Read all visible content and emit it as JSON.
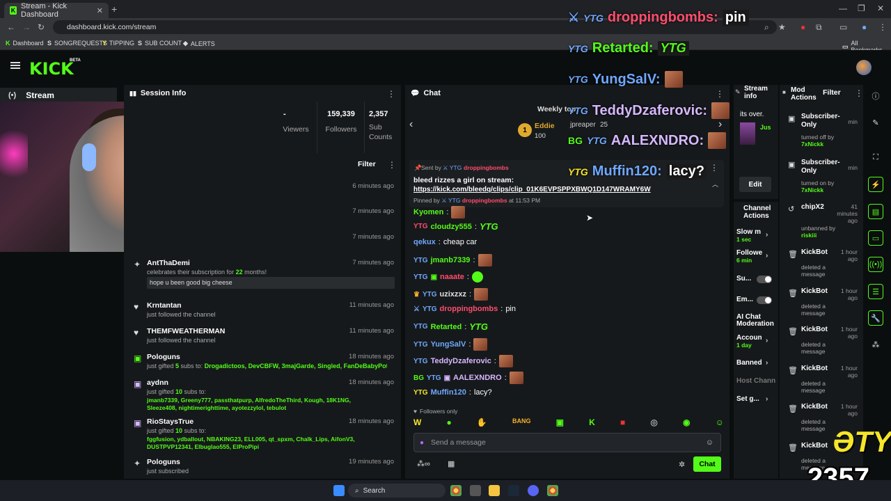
{
  "browser": {
    "tab_title": "Stream - Kick Dashboard",
    "url": "dashboard.kick.com/stream",
    "bookmarks": [
      "Dashboard",
      "SONGREQUESTS",
      "TIPPING",
      "SUB COUNT",
      "ALERTS"
    ],
    "all_bookmarks": "All Bookmarks"
  },
  "header": {
    "logo": "KICK",
    "beta": "BETA"
  },
  "nav": {
    "stream_label": "Stream"
  },
  "session_info": {
    "title": "Session Info",
    "viewers_value": "-",
    "viewers_label": "Viewers",
    "followers_value": "159,339",
    "followers_label": "Followers",
    "subs_value": "2,357",
    "subs_label": "Sub Counts",
    "filter_label": "Filter",
    "events": [
      {
        "user": "",
        "desc": "",
        "time": "6 minutes ago"
      },
      {
        "user": "",
        "desc": "",
        "time": "7 minutes ago"
      },
      {
        "user": "",
        "desc": "",
        "time": "7 minutes ago"
      },
      {
        "user": "AntThaDemi",
        "desc_prefix": "celebrates their subscription for ",
        "desc_months": "22",
        "desc_suffix": " months!",
        "message": "hope u been good big cheese",
        "time": "7 minutes ago"
      },
      {
        "user": "Krntantan",
        "desc": "just followed the channel",
        "time": "11 minutes ago"
      },
      {
        "user": "THEMFWEATHERMAN",
        "desc": "just followed the channel",
        "time": "11 minutes ago"
      },
      {
        "user": "Pologuns",
        "desc_prefix": "just gifted ",
        "desc_count": "5",
        "desc_suffix": " subs to: ",
        "list": "Drogadictoos, DevCBFW, 3majGarde, Singled, FanDeBabyPot",
        "time": "18 minutes ago"
      },
      {
        "user": "aydnn",
        "desc_prefix": "just gifted ",
        "desc_count": "10",
        "desc_suffix": " subs to:",
        "list": "jmanb7339, Greeny777, passthatpurp, AlfredoTheThird, Kough, 18K1NG, Sleeze408, nightimerighttime, ayotezzylol, tebulot",
        "time": "18 minutes ago"
      },
      {
        "user": "RioStaysTrue",
        "desc_prefix": "just gifted ",
        "desc_count": "10",
        "desc_suffix": " subs to:",
        "list": "fggfusion, ydballout, NBAKING23, ELL005, qt_spxm, Chalk_Lips, AifonV3, DUSTPVP12341, Elbuglao555, ElProPipi",
        "time": "18 minutes ago"
      },
      {
        "user": "Pologuns",
        "desc": "just subscribed",
        "time": "19 minutes ago"
      }
    ]
  },
  "chat": {
    "title": "Chat",
    "weekly_top": "Weekly top",
    "leader_name": "Eddie",
    "leader_score": "100",
    "leader_rank": "1",
    "second_name": "jpreaper",
    "second_score": "25",
    "pinned": {
      "sent_by": "Sent by",
      "sender": "droppingbombs",
      "text": "bleed rizzes a girl on stream:",
      "link": "https://kick.com/bleedq/clips/clip_01K6EVPSPPXBWQ1D147WRAMY6W",
      "pinned_by": "Pinned by",
      "pinned_by_user": "droppingbombs",
      "pinned_at": "at 11:53 PM"
    },
    "messages": [
      {
        "user": "Kyomen",
        "text": "",
        "color": "#53fc18"
      },
      {
        "user": "cloudzy555",
        "text": "",
        "color": "#53fc18"
      },
      {
        "user": "qekux",
        "text": "cheap car",
        "color": "#6fa8ff"
      },
      {
        "user": "jmanb7339",
        "text": "",
        "color": "#53fc18"
      },
      {
        "user": "naaate",
        "text": "",
        "color": "#ff4d6d"
      },
      {
        "user": "uzixzxz",
        "text": "",
        "color": "#e0e0e0"
      },
      {
        "user": "droppingbombs",
        "text": "pin",
        "color": "#ff4d6d"
      },
      {
        "user": "Retarted",
        "text": "",
        "color": "#53fc18"
      },
      {
        "user": "YungSalV",
        "text": "",
        "color": "#6fa8ff"
      },
      {
        "user": "TeddyDzaferovic",
        "text": "",
        "color": "#d6b8ff"
      },
      {
        "user": "AALEXNDRO",
        "text": "",
        "color": "#d6b8ff"
      },
      {
        "user": "Muffin120",
        "text": "lacy?",
        "color": "#6fa8ff"
      }
    ],
    "followers_only": "Followers only",
    "input_placeholder": "Send a message",
    "send_label": "Chat"
  },
  "overlay": {
    "lines": [
      {
        "user": "droppingbombs:",
        "text": "pin",
        "color": "#ff4d6d"
      },
      {
        "user": "Retarted:",
        "text": "",
        "color": "#53fc18"
      },
      {
        "user": "YungSalV:",
        "text": "",
        "color": "#6fa8ff"
      },
      {
        "user": "TeddyDzaferovic:",
        "text": "",
        "color": "#d6b8ff"
      },
      {
        "user": "AALEXNDRO:",
        "text": "",
        "color": "#d6b8ff"
      },
      {
        "user": "Muffin120:",
        "text": "lacy?",
        "color": "#6fa8ff"
      }
    ],
    "sub_count": "2357",
    "ytg": "ƏTY"
  },
  "stream_info": {
    "title": "Stream info",
    "snippet": "its over.",
    "user_prefix": "Jus",
    "edit_label": "Edit"
  },
  "channel_actions": {
    "title": "Channel Actions",
    "slow_mode": "Slow m",
    "slow_value": "1 sec",
    "followers": "Followe",
    "followers_value": "6 min",
    "sub_label": "Su...",
    "emote_label": "Em...",
    "ai_mod": "AI Chat Moderation",
    "account_age": "Accoun",
    "account_value": "1 day",
    "banned": "Banned",
    "host": "Host Channe",
    "set_goal": "Set g..."
  },
  "mod_actions": {
    "title": "Mod Actions",
    "filter_label": "Filter",
    "items": [
      {
        "user": "Subscriber-Only",
        "desc": "turned off by",
        "by": "7xNickk",
        "time": "min"
      },
      {
        "user": "Subscriber-Only",
        "desc": "turned on by",
        "by": "7xNickk",
        "time": "min"
      },
      {
        "user": "chipX2",
        "desc": "unbanned by",
        "by": "riskiii",
        "time": "41 minutes ago"
      },
      {
        "user": "KickBot",
        "desc": "deleted a message",
        "by": "",
        "time": "1 hour ago"
      },
      {
        "user": "KickBot",
        "desc": "deleted a message",
        "by": "",
        "time": "1 hour ago"
      },
      {
        "user": "KickBot",
        "desc": "deleted a message",
        "by": "",
        "time": "1 hour ago"
      },
      {
        "user": "KickBot",
        "desc": "deleted a message",
        "by": "",
        "time": "1 hour ago"
      },
      {
        "user": "KickBot",
        "desc": "deleted a message",
        "by": "",
        "time": "1 hour ago"
      },
      {
        "user": "KickBot",
        "desc": "deleted a message",
        "by": "",
        "time": ""
      }
    ]
  },
  "taskbar": {
    "search_label": "Search"
  },
  "colors": {
    "accent": "#53fc18",
    "panel": "#16191b",
    "background": "#0b0e0f"
  }
}
